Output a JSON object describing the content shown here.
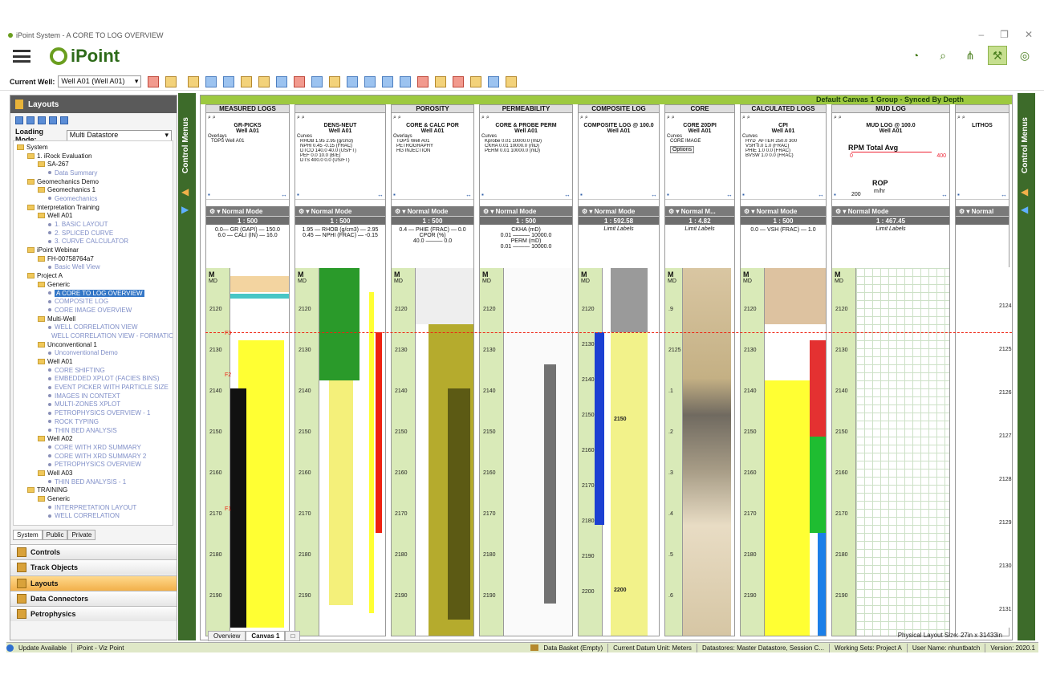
{
  "window": {
    "title": "iPoint System - A CORE TO LOG OVERVIEW",
    "controls": [
      "–",
      "❐",
      "✕"
    ]
  },
  "app": {
    "name": "iPoint"
  },
  "toolbar": {
    "current_well_label": "Current Well:",
    "current_well_value": "Well A01 (Well A01)"
  },
  "left_panel": {
    "title": "Layouts",
    "loading_mode_label": "Loading Mode:",
    "loading_mode_value": "Multi Datastore",
    "tree": [
      {
        "label": "System",
        "level": 0,
        "kind": "folder"
      },
      {
        "label": "1. iRock Evaluation",
        "level": 1,
        "kind": "folder"
      },
      {
        "label": "SA-267",
        "level": 2,
        "kind": "folder"
      },
      {
        "label": "Data Summary",
        "level": 3,
        "kind": "link"
      },
      {
        "label": "Geomechanics Demo",
        "level": 1,
        "kind": "folder"
      },
      {
        "label": "Geomechanics 1",
        "level": 2,
        "kind": "folder"
      },
      {
        "label": "Geomechanics",
        "level": 3,
        "kind": "link"
      },
      {
        "label": "Interpretation Training",
        "level": 1,
        "kind": "folder"
      },
      {
        "label": "Well A01",
        "level": 2,
        "kind": "folder"
      },
      {
        "label": "1. BASIC LAYOUT",
        "level": 3,
        "kind": "link"
      },
      {
        "label": "2. SPLICED CURVE",
        "level": 3,
        "kind": "link"
      },
      {
        "label": "3. CURVE CALCULATOR",
        "level": 3,
        "kind": "link"
      },
      {
        "label": "iPoint Webinar",
        "level": 1,
        "kind": "folder"
      },
      {
        "label": "FH-00758764a7",
        "level": 2,
        "kind": "folder"
      },
      {
        "label": "Basic Well View",
        "level": 3,
        "kind": "link"
      },
      {
        "label": "Project A",
        "level": 1,
        "kind": "folder"
      },
      {
        "label": "Generic",
        "level": 2,
        "kind": "folder"
      },
      {
        "label": "A CORE TO LOG OVERVIEW",
        "level": 3,
        "kind": "selected"
      },
      {
        "label": "COMPOSITE LOG",
        "level": 3,
        "kind": "link"
      },
      {
        "label": "CORE IMAGE OVERVIEW",
        "level": 3,
        "kind": "link"
      },
      {
        "label": "Multi-Well",
        "level": 2,
        "kind": "folder"
      },
      {
        "label": "WELL CORRELATION VIEW",
        "level": 3,
        "kind": "link"
      },
      {
        "label": "WELL CORRELATION VIEW - FORMATION SI",
        "level": 3,
        "kind": "link"
      },
      {
        "label": "Unconventional 1",
        "level": 2,
        "kind": "folder"
      },
      {
        "label": "Unconventional Demo",
        "level": 3,
        "kind": "link"
      },
      {
        "label": "Well A01",
        "level": 2,
        "kind": "folder"
      },
      {
        "label": "CORE SHIFTING",
        "level": 3,
        "kind": "link"
      },
      {
        "label": "EMBEDDED XPLOT (FACIES BINS)",
        "level": 3,
        "kind": "link"
      },
      {
        "label": "EVENT PICKER WITH PARTICLE SIZE",
        "level": 3,
        "kind": "link"
      },
      {
        "label": "IMAGES IN CONTEXT",
        "level": 3,
        "kind": "link"
      },
      {
        "label": "MULTI-ZONES XPLOT",
        "level": 3,
        "kind": "link"
      },
      {
        "label": "PETROPHYSICS OVERVIEW - 1",
        "level": 3,
        "kind": "link"
      },
      {
        "label": "ROCK TYPING",
        "level": 3,
        "kind": "link"
      },
      {
        "label": "THIN BED ANALYSIS",
        "level": 3,
        "kind": "link"
      },
      {
        "label": "Well A02",
        "level": 2,
        "kind": "folder"
      },
      {
        "label": "CORE WITH XRD SUMMARY",
        "level": 3,
        "kind": "link"
      },
      {
        "label": "CORE WITH XRD SUMMARY 2",
        "level": 3,
        "kind": "link"
      },
      {
        "label": "PETROPHYSICS OVERVIEW",
        "level": 3,
        "kind": "link"
      },
      {
        "label": "Well A03",
        "level": 2,
        "kind": "folder"
      },
      {
        "label": "THIN BED ANALYSIS - 1",
        "level": 3,
        "kind": "link"
      },
      {
        "label": "TRAINING",
        "level": 1,
        "kind": "folder"
      },
      {
        "label": "Generic",
        "level": 2,
        "kind": "folder"
      },
      {
        "label": "INTERPRETATION LAYOUT",
        "level": 3,
        "kind": "link"
      },
      {
        "label": "WELL CORRELATION",
        "level": 3,
        "kind": "link"
      }
    ],
    "tree_tabs": [
      "System",
      "Public",
      "Private"
    ],
    "accordion": [
      "Controls",
      "Track Objects",
      "Layouts",
      "Data Connectors",
      "Petrophysics"
    ],
    "control_menus_label": "Control Menus"
  },
  "canvas": {
    "header": "Default Canvas 1 Group - Synced By Depth",
    "normal_mode": "Normal Mode",
    "normal_mode_short": "Normal M...",
    "normal_mode_cut": "Normal",
    "limit_labels": "Limit Labels",
    "md_label": "M",
    "md_sub": "MD",
    "tracks": [
      {
        "group": "MEASURED LOGS",
        "title": "GR-PICKS",
        "well": "Well A01",
        "scale": "1 : 500",
        "legend1": "0.0— GR (GAPI) — 150.0",
        "legend2": "6.0 — CALI (IN) — 16.0",
        "sub": "Overlays",
        "item": "TOPS Well A01"
      },
      {
        "group": "",
        "title": "DENS-NEUT",
        "well": "Well A01",
        "scale": "1 : 500",
        "legend1": "1.95 — RHOB (g/cm3) — 2.95",
        "legend2": "0.45 — NPHI (FRAC) — -0.15",
        "sub": "Curves",
        "items": [
          "RHOB 1.95 2.95 (g/cm3)",
          "NPHI 0.45 -0.15 (FRAC)",
          "DTCO 140.0 40.0 (US/FT)",
          "PEF 0.0 10.0 (B/E)",
          "DTS 400.0 0.0 (US/FT)"
        ]
      },
      {
        "group": "POROSITY",
        "title": "CORE & CALC POR",
        "well": "Well A01",
        "scale": "1 : 500",
        "legend1": "0.4 — PHIE (FRAC) — 0.0",
        "legend2": "CPOR (%)",
        "legend3": "40.0 ——— 0.0",
        "sub": "Overlays",
        "items": [
          "TOPS Well A01",
          "PETROGRAPHY",
          "HG INJECTION"
        ]
      },
      {
        "group": "PERMEABILITY",
        "title": "CORE & PROBE PERM",
        "well": "Well A01",
        "scale": "1 : 500",
        "legend1": "CKHA (mD)",
        "legend2": "0.01 ——— 10000.0",
        "legend3": "PERM (mD)",
        "legend4": "0.01 ——— 10000.0",
        "sub": "Curves",
        "items": [
          "Kprobe 0.01 10000.0 (mD)",
          "CKHA 0.01 10000.0 (mD)",
          "PERM 0.01 10000.0 (mD)"
        ]
      },
      {
        "group": "COMPOSITE LOG",
        "title": "COMPOSITE LOG @ 100.0",
        "well": "Well A01",
        "scale": "1 : 592.58"
      },
      {
        "group": "CORE",
        "title": "CORE 20DPI",
        "well": "Well A01",
        "scale": "1 : 4.82",
        "sub": "Curves",
        "item": "CORE IMAGE",
        "button": "Options"
      },
      {
        "group": "CALCULATED LOGS",
        "title": "CPI",
        "well": "Well A01",
        "scale": "1 : 500",
        "legend1": "0.0 — VSH (FRAC) — 1.0",
        "sub": "Curves",
        "items": [
          "HYD_AFTER 250.0 300",
          "VSH 0.0 1.0 (FRAC)",
          "PHIE 1.0 0.0 (FRAC)",
          "BVSW 1.0 0.0 (FRAC)"
        ]
      },
      {
        "group": "MUD LOG",
        "title": "MUD LOG @ 100.0",
        "well": "Well A01",
        "scale": "1 : 467.45",
        "legend1": "RPM Total Avg",
        "legend2": "ROP",
        "legend3": "m/hr",
        "legend4": "200",
        "legend5": "0",
        "legend6": "400"
      },
      {
        "group": "",
        "title": "LITHOS",
        "well": "",
        "scale": ""
      }
    ],
    "depths_a": [
      "2120",
      "2130",
      "2140",
      "2150",
      "2160",
      "2170",
      "2180",
      "2190"
    ],
    "depths_composite": [
      "2120",
      "2130",
      "2140",
      "2150",
      "2160",
      "2170",
      "2180",
      "2190",
      "2200"
    ],
    "depths_core": [
      ".9",
      "2125",
      ".1",
      ".2",
      ".3",
      ".4",
      ".5",
      ".6"
    ],
    "depths_right": [
      "2124",
      "2125",
      "2126",
      "2127",
      "2128",
      "2129",
      "2130",
      "2131"
    ],
    "core_labels": [
      "2150",
      "2200"
    ],
    "tops": [
      "F3",
      "F2",
      "F1"
    ]
  },
  "tabs": [
    "Overview",
    "Canvas 1"
  ],
  "layout_size": "Physical Layout Size: 27in x 31433in",
  "status": [
    "Update Available",
    "iPoint - Viz Point",
    "Data Basket (Empty)",
    "Current Datum Unit: Meters",
    "Datastores: Master Datastore, Session C...",
    "Working Sets: Project A",
    "User Name: nhuntbatch",
    "Version: 2020.1"
  ]
}
